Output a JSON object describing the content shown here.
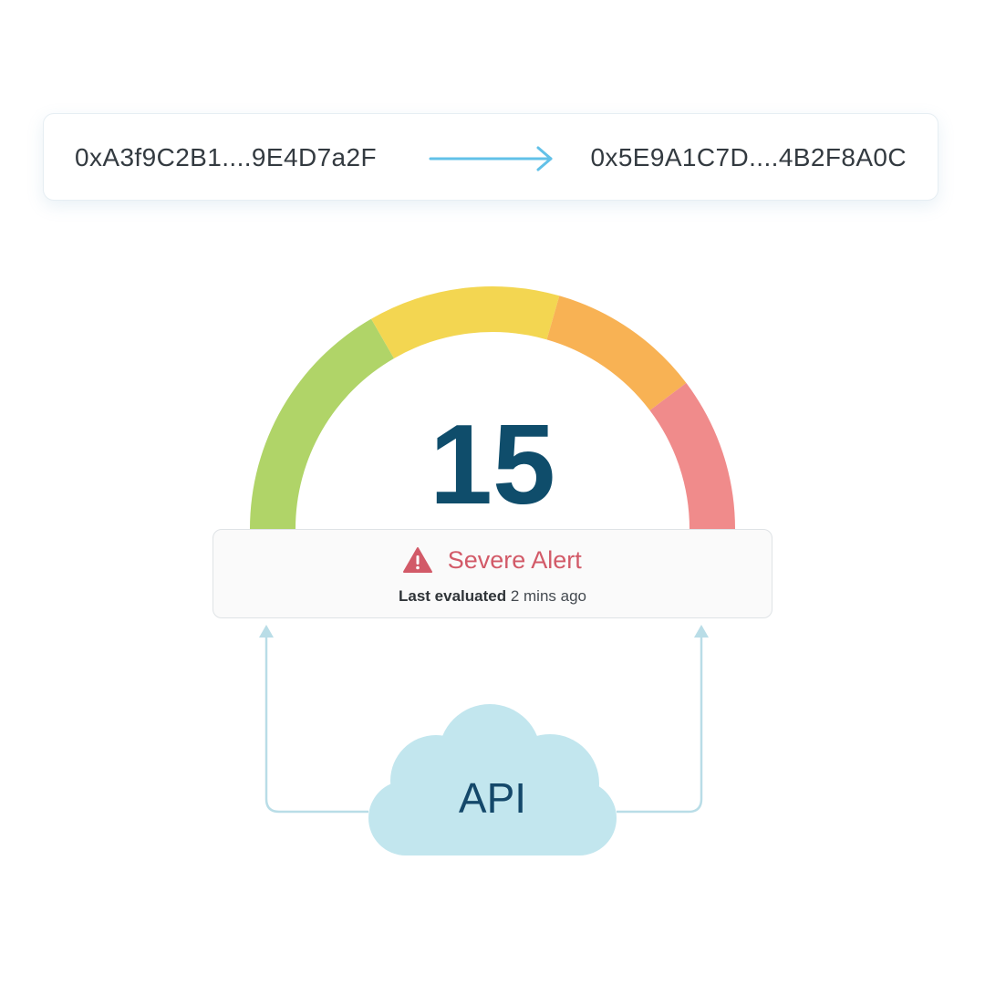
{
  "transaction": {
    "from_address": "0xA3f9C2B1....9E4D7a2F",
    "to_address": "0x5E9A1C7D....4B2F8A0C",
    "arrow_icon": "right-arrow-icon"
  },
  "gauge": {
    "score": "15",
    "segment_colors": [
      "#b0d468",
      "#f3d651",
      "#f8b254",
      "#f08b8b"
    ]
  },
  "alert": {
    "icon": "warning-triangle-icon",
    "title": "Severe Alert",
    "eval_label": "Last evaluated",
    "eval_value": "2 mins ago",
    "color": "#d25a68"
  },
  "api": {
    "label": "API",
    "icon": "cloud-icon"
  },
  "colors": {
    "accent_line": "#b9dde7",
    "arrow": "#62c1e8",
    "score_text": "#0f4d6b",
    "cloud": "#c2e6ee"
  }
}
